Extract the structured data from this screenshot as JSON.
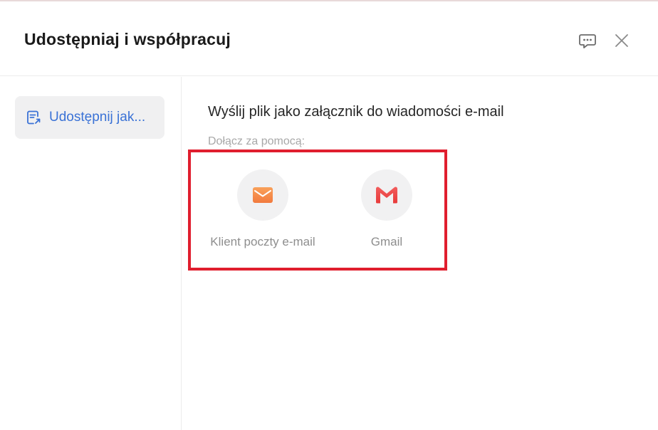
{
  "dialog": {
    "title": "Udostępniaj i współpracuj"
  },
  "header": {
    "feedback_icon": "chat-feedback-icon",
    "close_icon": "close-icon"
  },
  "sidebar": {
    "items": [
      {
        "label": "Udostępnij jak...",
        "icon": "share-file-icon",
        "active": true,
        "accent": "#3a72d6"
      }
    ]
  },
  "main": {
    "heading": "Wyślij plik jako załącznik do wiadomości e-mail",
    "sublabel": "Dołącz za pomocą:",
    "options": [
      {
        "label": "Klient poczty e-mail",
        "icon": "envelope-icon",
        "color": "#f58a4b"
      },
      {
        "label": "Gmail",
        "icon": "gmail-icon",
        "color": "#ef4a4a"
      }
    ]
  },
  "colors": {
    "highlight_border": "#e01e2e",
    "active_text": "#3a72d6"
  }
}
